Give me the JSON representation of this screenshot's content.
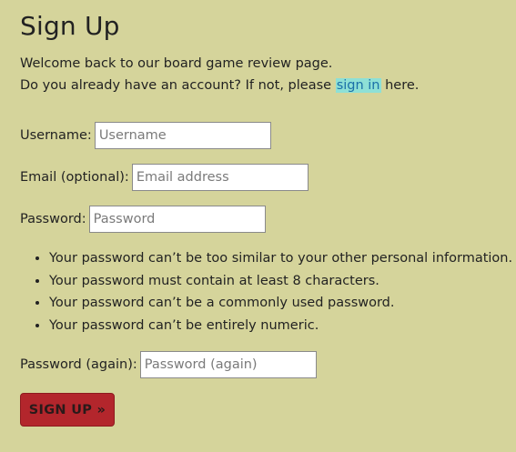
{
  "page": {
    "title": "Sign Up",
    "intro_line1": "Welcome back to our board game review page.",
    "intro_line2_prefix": "Do you already have an account? If not, please ",
    "signin_link": "sign in",
    "intro_line2_suffix": " here."
  },
  "form": {
    "username": {
      "label": "Username:",
      "placeholder": "Username",
      "value": ""
    },
    "email": {
      "label": "Email (optional):",
      "placeholder": "Email address",
      "value": ""
    },
    "password1": {
      "label": "Password:",
      "placeholder": "Password",
      "value": ""
    },
    "password_help": [
      "Your password can’t be too similar to your other personal information.",
      "Your password must contain at least 8 characters.",
      "Your password can’t be a commonly used password.",
      "Your password can’t be entirely numeric."
    ],
    "password2": {
      "label": "Password (again):",
      "placeholder": "Password (again)",
      "value": ""
    },
    "submit_label": "SIGN UP »"
  },
  "colors": {
    "background": "#d5d49b",
    "button": "#b3262c",
    "link_highlight": "#8ee0d6",
    "link_text": "#1a6fa8"
  }
}
